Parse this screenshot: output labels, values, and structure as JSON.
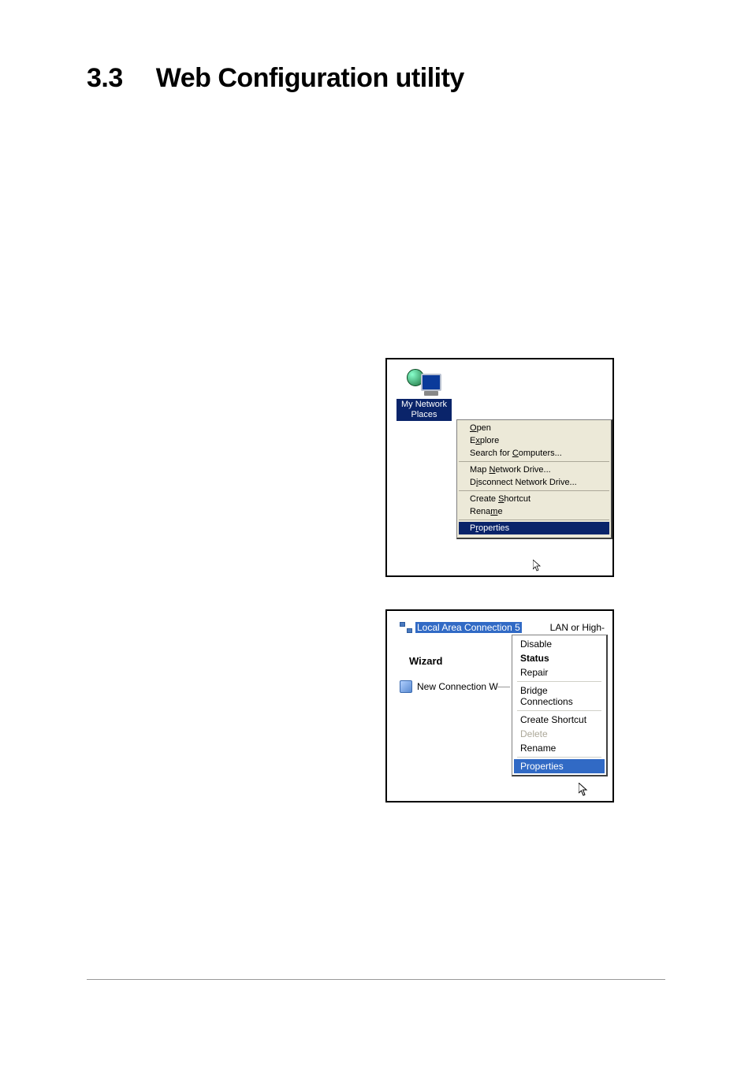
{
  "heading": {
    "number": "3.3",
    "title": "Web Configuration utility"
  },
  "box1": {
    "icon_label_line1": "My Network",
    "icon_label_line2": "Places",
    "menu": {
      "group1": [
        {
          "pre": "",
          "u": "O",
          "post": "pen"
        },
        {
          "pre": "E",
          "u": "x",
          "post": "plore"
        },
        {
          "pre": "Search for ",
          "u": "C",
          "post": "omputers..."
        }
      ],
      "group2": [
        {
          "pre": "Map ",
          "u": "N",
          "post": "etwork Drive..."
        },
        {
          "pre": "D",
          "u": "i",
          "post": "sconnect Network Drive..."
        }
      ],
      "group3": [
        {
          "pre": "Create ",
          "u": "S",
          "post": "hortcut"
        },
        {
          "pre": "Rena",
          "u": "m",
          "post": "e"
        }
      ],
      "selected": {
        "pre": "P",
        "u": "r",
        "post": "operties"
      }
    }
  },
  "box2": {
    "lac_label": "Local Area Connection 5",
    "lan_text": "LAN or High-",
    "wizard": "Wizard",
    "new_connection": "New Connection W",
    "menu": {
      "items1": [
        "Disable",
        "Status",
        "Repair"
      ],
      "items2": [
        "Bridge Connections"
      ],
      "items3_a": "Create Shortcut",
      "items3_disabled": "Delete",
      "items3_c": "Rename",
      "selected": "Properties"
    },
    "status_bold_index": 1
  }
}
